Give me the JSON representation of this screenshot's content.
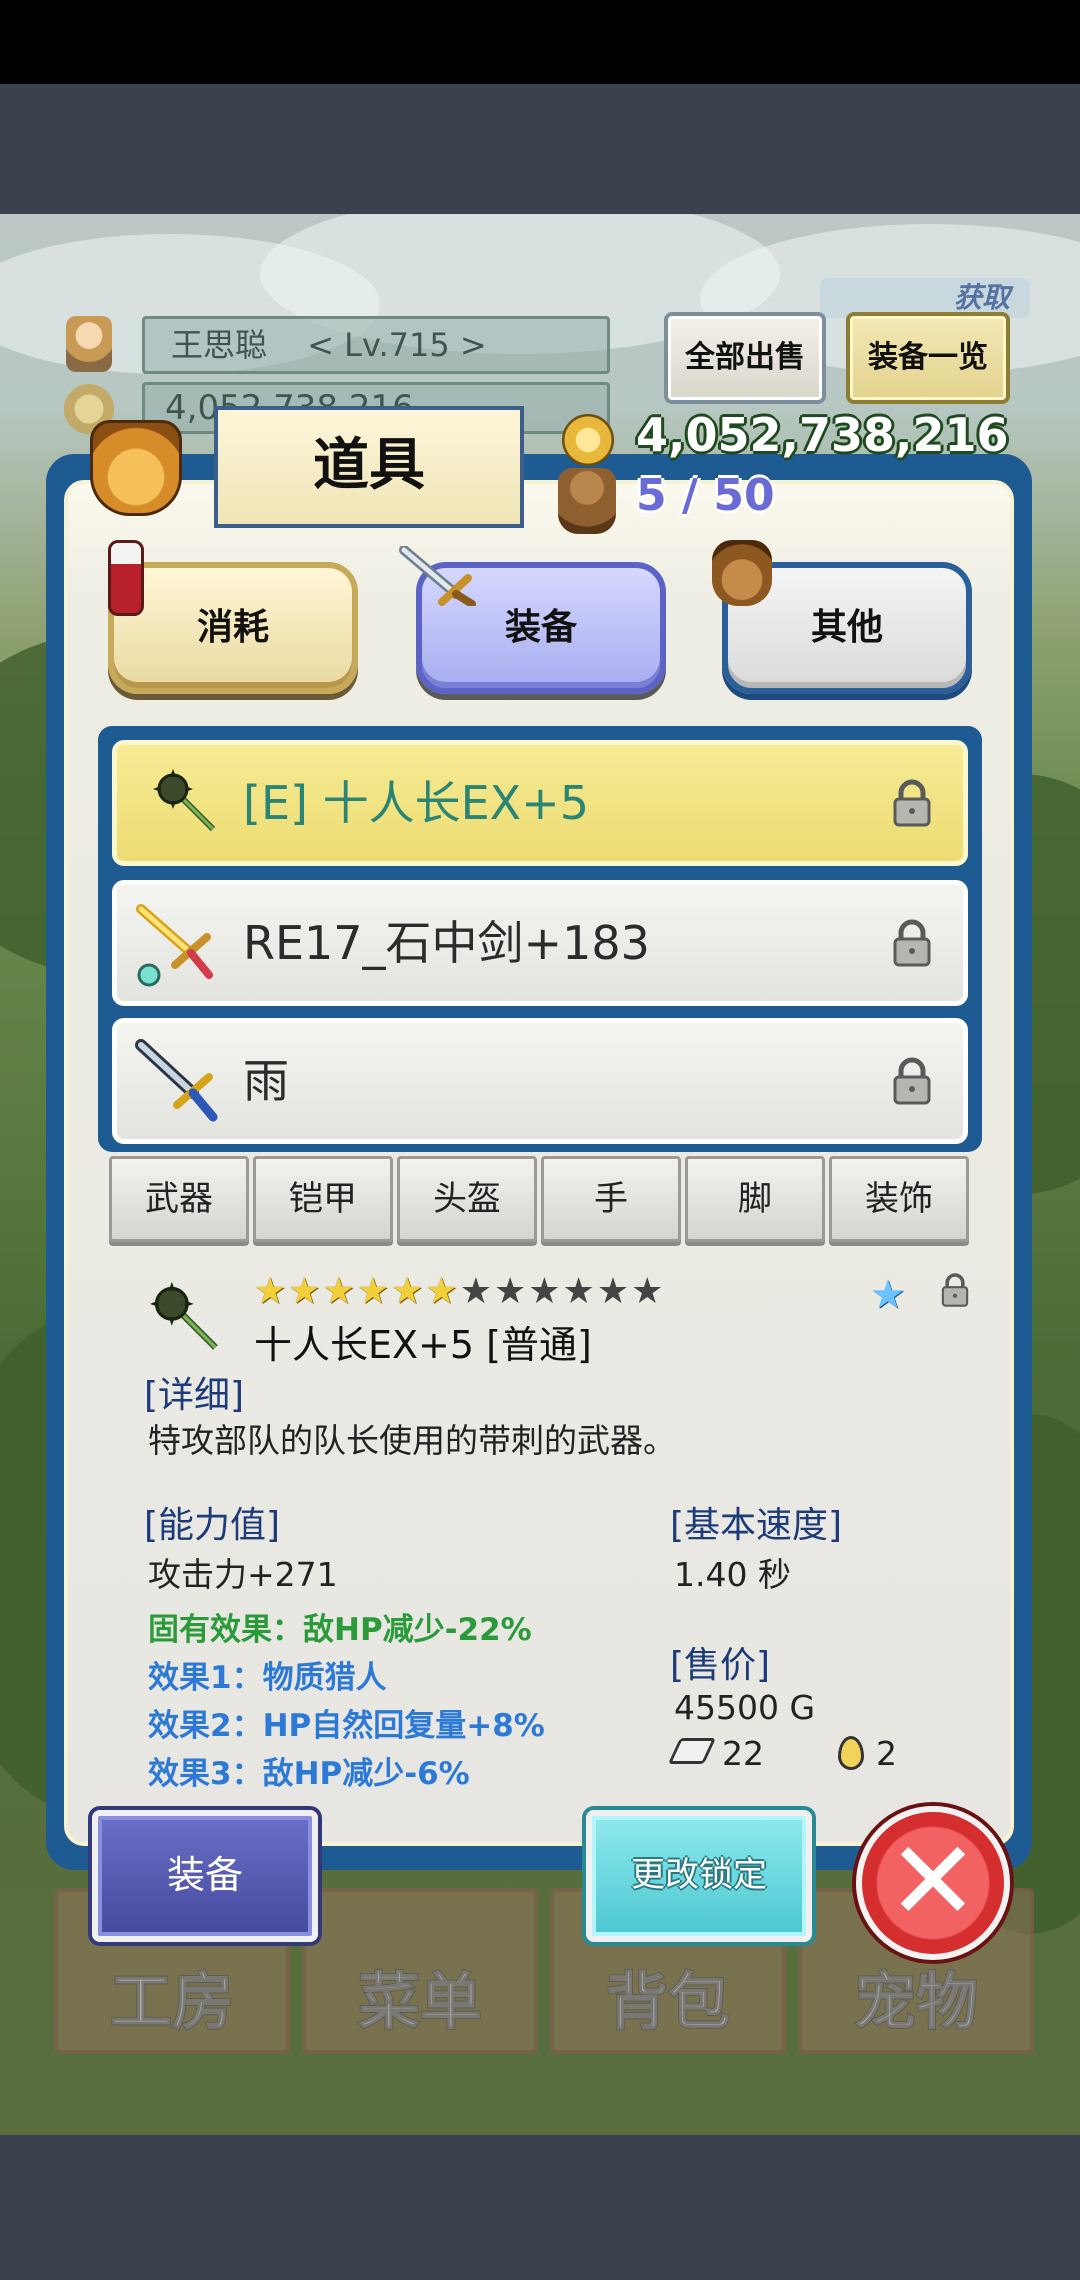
{
  "player": {
    "name": "王思聪",
    "level": "< Lv.715 >",
    "gold_faded": "4,052,738,216"
  },
  "header_buttons": {
    "sell_all": "全部出售",
    "equip_list": "装备一览",
    "ghost_label": "获取"
  },
  "currency": {
    "gold": "4,052,738,216",
    "capacity": "5 / 50"
  },
  "panel": {
    "title": "道具"
  },
  "categories": [
    {
      "label": "消耗"
    },
    {
      "label": "装备"
    },
    {
      "label": "其他"
    }
  ],
  "items": [
    {
      "label": "[E] 十人长EX+5"
    },
    {
      "label": "RE17_石中剑+183"
    },
    {
      "label": "雨"
    }
  ],
  "slot_tabs": [
    "武器",
    "铠甲",
    "头盔",
    "手",
    "脚",
    "装饰"
  ],
  "detail": {
    "stars_total": 12,
    "stars_filled": 6,
    "name": "十人长EX+5 [普通]",
    "section_detail": "[详细]",
    "description": "特攻部队的队长使用的带刺的武器。",
    "section_stats": "[能力值]",
    "attack": "攻击力+271",
    "intrinsic": "固有效果：敌HP减少-22%",
    "effect1": "效果1：物质猎人",
    "effect2": "效果2：HP自然回复量+8%",
    "effect3": "效果3：敌HP减少-6%",
    "section_speed": "[基本速度]",
    "speed": "1.40 秒",
    "section_price": "[售价]",
    "price": "45500 G",
    "whetstone_count": "22",
    "drop_count": "2"
  },
  "actions": {
    "equip": "装备",
    "change_lock": "更改锁定",
    "close_glyph": "✕"
  },
  "bottom_nav": [
    "工房",
    "菜单",
    "背包",
    "宠物"
  ],
  "colors": {
    "panel_frame": "#1e5b93",
    "selected_row": "#f6eb94",
    "equip_tab": "#a7acef",
    "effect_green": "#2a9a3a",
    "effect_blue": "#2c7ad6",
    "close_red": "#d42e2e"
  }
}
